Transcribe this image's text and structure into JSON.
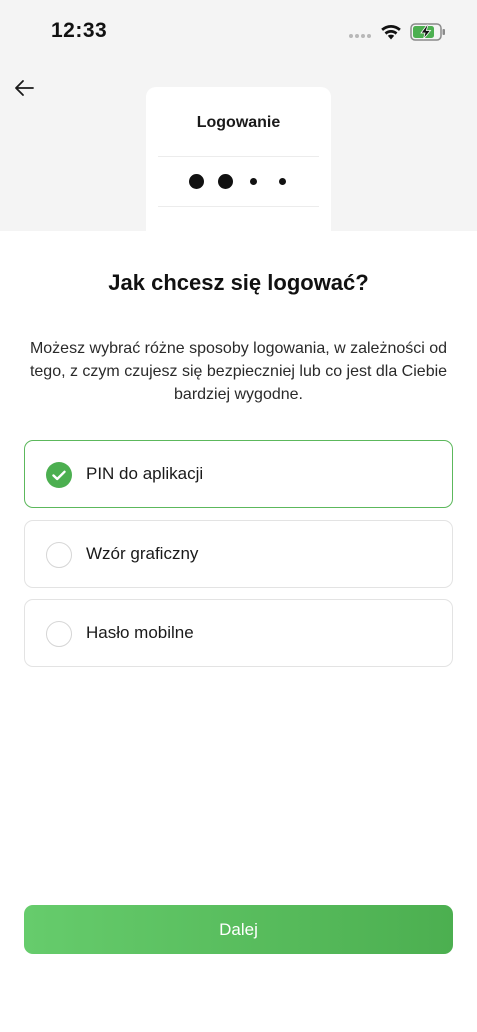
{
  "status_bar": {
    "time": "12:33",
    "icons": [
      "signal-dots-icon",
      "wifi-icon",
      "battery-charging-icon"
    ],
    "battery_color": "#4caf50"
  },
  "header": {
    "back_icon": "arrow-left-icon"
  },
  "preview": {
    "title": "Logowanie",
    "pin_dots_filled": 2,
    "pin_dots_total": 4
  },
  "main": {
    "heading": "Jak chcesz się logować?",
    "description": "Możesz wybrać różne sposoby logowania, w zależności od tego, z czym czujesz się bezpieczniej lub co jest dla Ciebie bardziej wygodne.",
    "options": [
      {
        "label": "PIN do aplikacji",
        "selected": true
      },
      {
        "label": "Wzór graficzny",
        "selected": false
      },
      {
        "label": "Hasło mobilne",
        "selected": false
      }
    ]
  },
  "footer": {
    "next_label": "Dalej"
  },
  "colors": {
    "accent": "#4caf50",
    "accent_light": "#66cc6c",
    "background_top": "#f4f4f4"
  }
}
